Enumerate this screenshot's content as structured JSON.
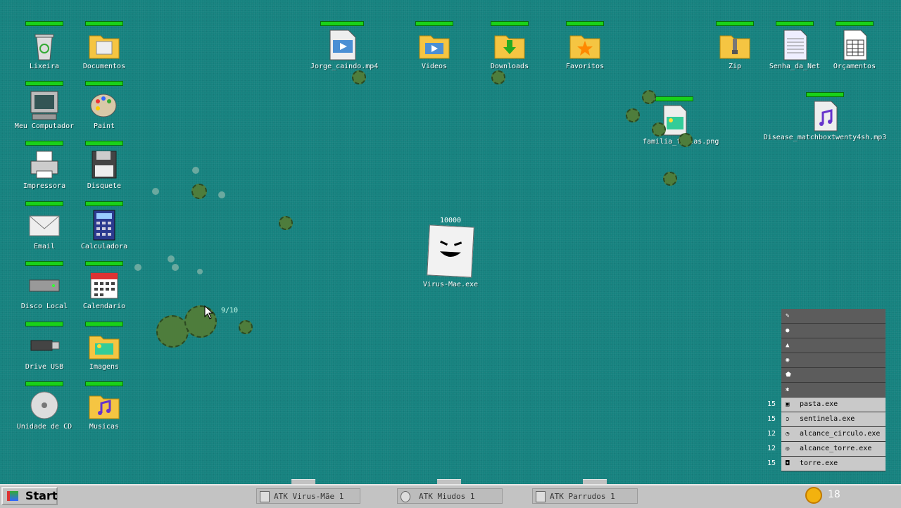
{
  "desktop_icons": [
    {
      "id": "lixeira",
      "label": "Lixeira",
      "icon": "recycle-bin-icon"
    },
    {
      "id": "documentos",
      "label": "Documentos",
      "icon": "folder-icon"
    },
    {
      "id": "meu_computador",
      "label": "Meu Computador",
      "icon": "computer-icon"
    },
    {
      "id": "paint",
      "label": "Paint",
      "icon": "palette-icon"
    },
    {
      "id": "impressora",
      "label": "Impressora",
      "icon": "printer-icon"
    },
    {
      "id": "disquete",
      "label": "Disquete",
      "icon": "floppy-icon"
    },
    {
      "id": "email",
      "label": "Email",
      "icon": "envelope-icon"
    },
    {
      "id": "calculadora",
      "label": "Calculadora",
      "icon": "calculator-icon"
    },
    {
      "id": "disco_local",
      "label": "Disco Local",
      "icon": "hard-drive-icon"
    },
    {
      "id": "calendario",
      "label": "Calendario",
      "icon": "calendar-icon"
    },
    {
      "id": "drive_usb",
      "label": "Drive USB",
      "icon": "usb-drive-icon"
    },
    {
      "id": "imagens",
      "label": "Imagens",
      "icon": "image-folder-icon"
    },
    {
      "id": "unidade_cd",
      "label": "Unidade de CD",
      "icon": "cd-icon"
    },
    {
      "id": "musicas",
      "label": "Musicas",
      "icon": "music-folder-icon"
    },
    {
      "id": "jorge",
      "label": "Jorge_caindo.mp4",
      "icon": "video-file-icon"
    },
    {
      "id": "videos",
      "label": "Videos",
      "icon": "video-folder-icon"
    },
    {
      "id": "downloads",
      "label": "Downloads",
      "icon": "download-folder-icon"
    },
    {
      "id": "favoritos",
      "label": "Favoritos",
      "icon": "star-folder-icon"
    },
    {
      "id": "zip",
      "label": "Zip",
      "icon": "zip-folder-icon"
    },
    {
      "id": "senha",
      "label": "Senha_da_Net",
      "icon": "text-file-icon"
    },
    {
      "id": "orcamentos",
      "label": "Orçamentos",
      "icon": "spreadsheet-icon"
    },
    {
      "id": "familia",
      "label": "familia_ferias.png",
      "icon": "image-file-icon"
    },
    {
      "id": "disease",
      "label": "Disease_matchboxtwenty4sh.mp3",
      "icon": "music-file-icon"
    }
  ],
  "boss": {
    "name": "Virus-Mae.exe",
    "hp": "10000"
  },
  "wave_counter": "9/10",
  "shop": {
    "locked_icons": [
      "pencil-icon",
      "bomb-icon",
      "drop-icon",
      "eye-icon",
      "shield-icon",
      "spider-icon"
    ],
    "items": [
      {
        "cost": "15",
        "name": "pasta.exe",
        "icon": "folder-icon"
      },
      {
        "cost": "15",
        "name": "sentinela.exe",
        "icon": "ear-icon"
      },
      {
        "cost": "12",
        "name": "alcance_circulo.exe",
        "icon": "clock-icon"
      },
      {
        "cost": "12",
        "name": "alcance_torre.exe",
        "icon": "target-icon"
      },
      {
        "cost": "15",
        "name": "torre.exe",
        "icon": "tower-icon"
      }
    ]
  },
  "taskbar": {
    "start_label": "Start",
    "tasks": [
      {
        "label": "ATK Virus-Mãe 1",
        "icon": "file-icon"
      },
      {
        "label": "ATK Miudos 1",
        "icon": "virus-icon"
      },
      {
        "label": "ATK Parrudos 1",
        "icon": "file-icon"
      }
    ],
    "coins": "18"
  },
  "colors": {
    "desktop": "#16827f",
    "hp_bar": "#19d119",
    "virus": "#4e7d3c",
    "coin": "#f3b20e"
  }
}
